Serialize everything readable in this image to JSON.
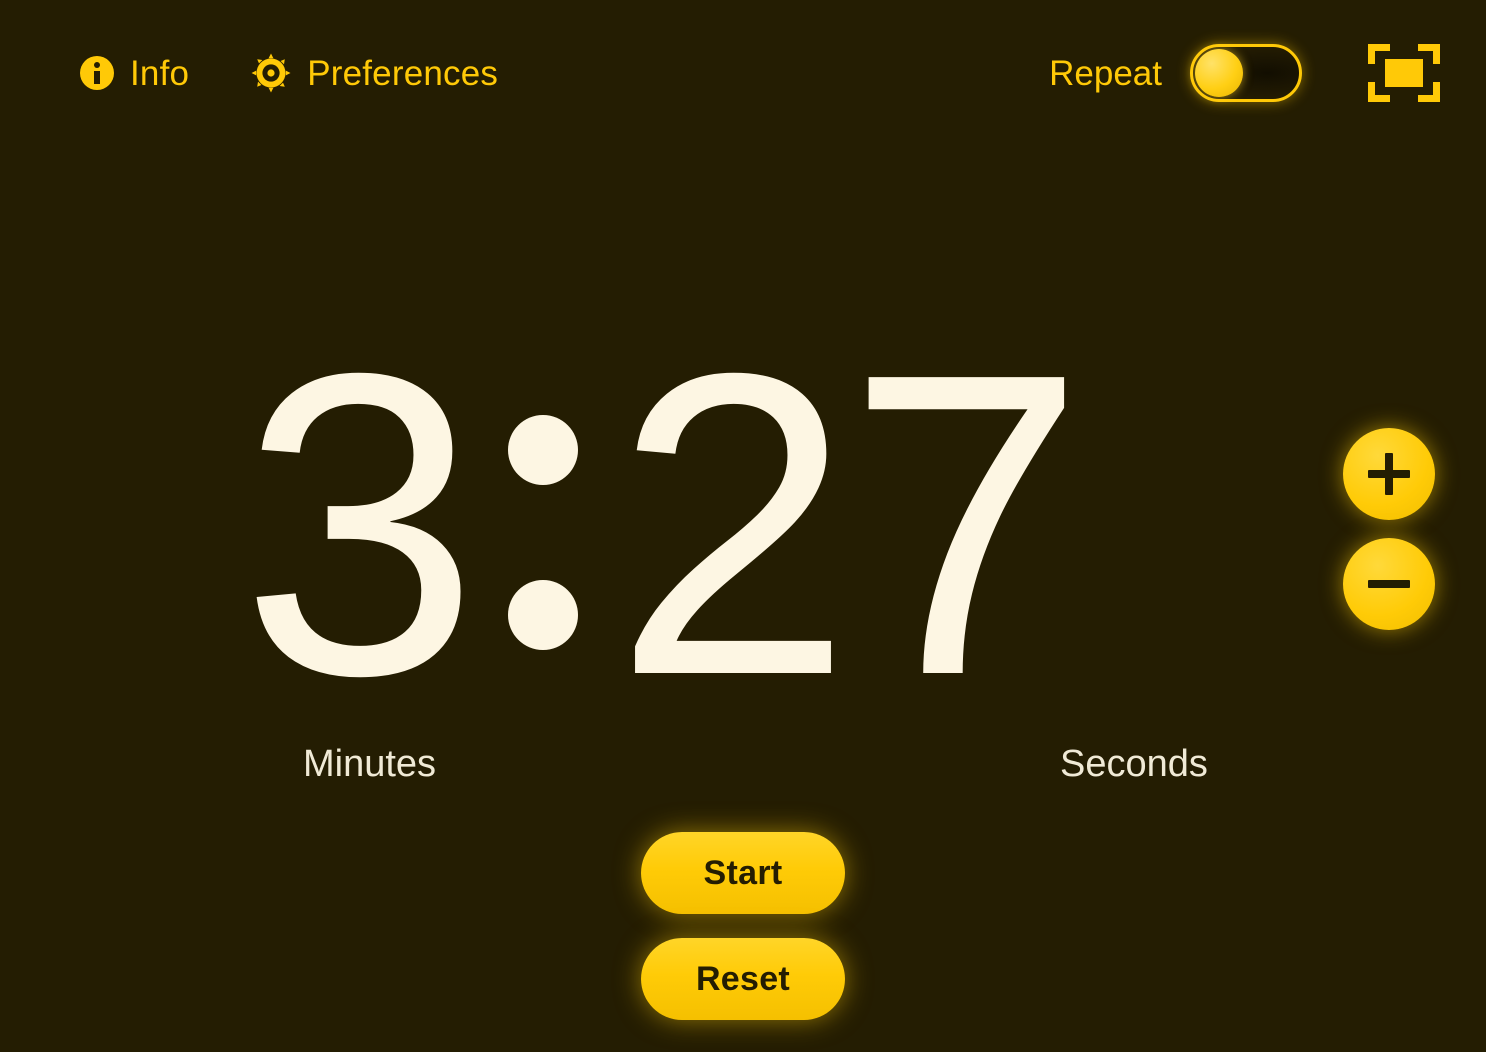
{
  "theme": {
    "background": "#241d02",
    "accent": "#ffc907",
    "digit_color": "#fdf6e3",
    "label_color": "#f0ead6"
  },
  "header": {
    "info": {
      "label": "Info",
      "icon": "info-circle-icon"
    },
    "preferences": {
      "label": "Preferences",
      "icon": "gear-icon"
    },
    "repeat": {
      "label": "Repeat",
      "state": "off",
      "icon": "toggle-switch-icon"
    },
    "fullscreen": {
      "icon": "fullscreen-icon"
    }
  },
  "timer": {
    "minutes": "3",
    "separator": ":",
    "seconds": "27",
    "minutes_label": "Minutes",
    "seconds_label": "Seconds",
    "stepper": {
      "increment": "+",
      "decrement": "−"
    }
  },
  "actions": {
    "start": "Start",
    "reset": "Reset"
  }
}
